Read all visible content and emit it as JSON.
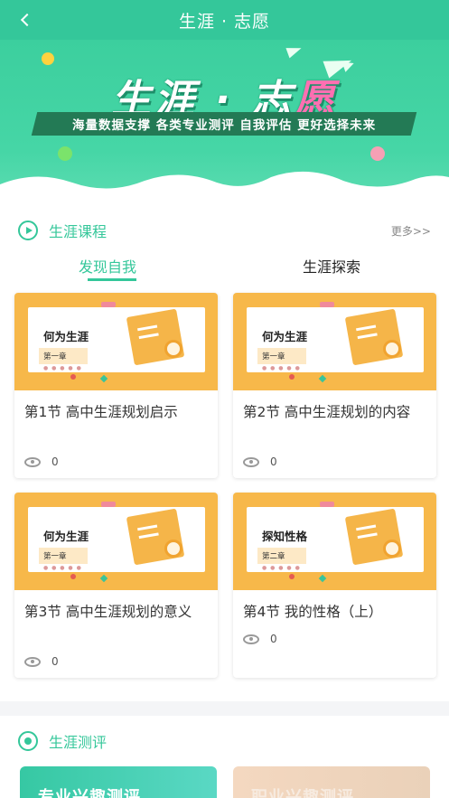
{
  "header": {
    "title": "生涯 · 志愿",
    "back_icon": "chevron-left-icon"
  },
  "banner": {
    "title_part1": "生涯 · 志",
    "title_part2": "愿",
    "slogan": "海量数据支撑  各类专业测评  自我评估  更好选择未来"
  },
  "course_section": {
    "title": "生涯课程",
    "more": "更多>>",
    "tabs": [
      {
        "label": "发现自我",
        "active": true
      },
      {
        "label": "生涯探索",
        "active": false
      }
    ],
    "cards": [
      {
        "thumb_title": "何为生涯",
        "thumb_chapter": "第一章",
        "thumb_dots": "● ● ● ● ●",
        "title": "第1节  高中生涯规划启示",
        "views": "0"
      },
      {
        "thumb_title": "何为生涯",
        "thumb_chapter": "第一章",
        "thumb_dots": "● ● ● ● ●",
        "title": "第2节  高中生涯规划的内容",
        "views": "0"
      },
      {
        "thumb_title": "何为生涯",
        "thumb_chapter": "第一章",
        "thumb_dots": "● ● ● ● ●",
        "title": "第3节 高中生涯规划的意义",
        "views": "0"
      },
      {
        "thumb_title": "探知性格",
        "thumb_chapter": "第二章",
        "thumb_dots": "● ● ● ● ●",
        "title": "第4节 我的性格（上）",
        "views": "0"
      }
    ]
  },
  "eval_section": {
    "title": "生涯测评",
    "cards": [
      {
        "label": "专业兴趣测评"
      },
      {
        "label": "职业兴趣测评"
      }
    ]
  },
  "colors": {
    "accent": "#34c79a",
    "thumb_bg": "#f7b84a"
  }
}
